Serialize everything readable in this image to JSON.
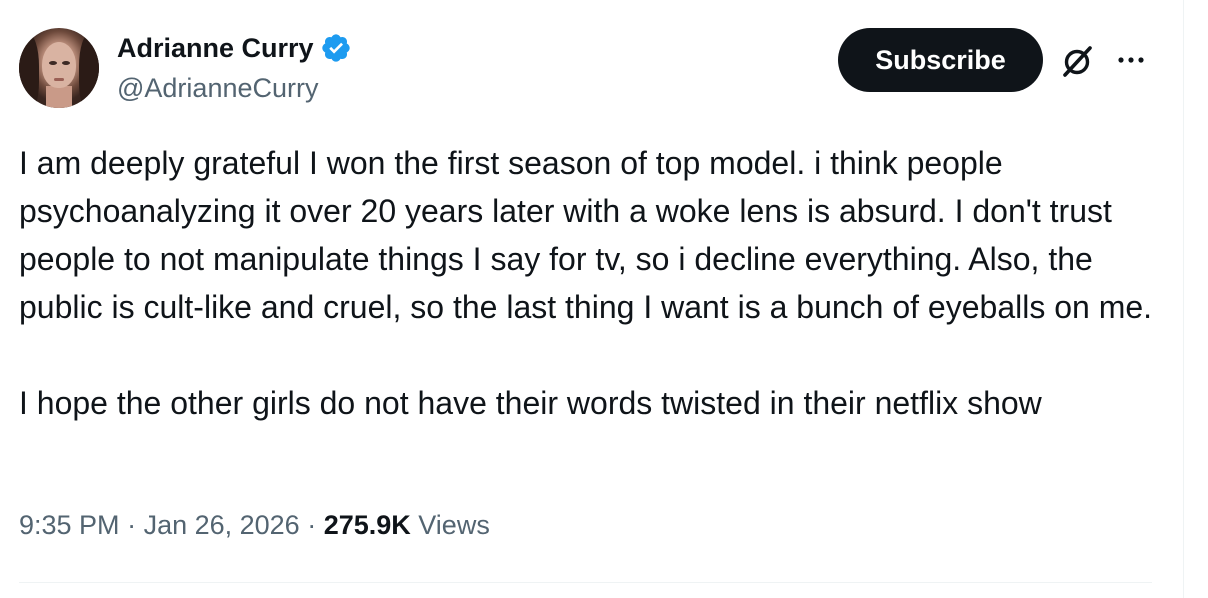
{
  "author": {
    "display_name": "Adrianne Curry",
    "handle": "@AdrianneCurry",
    "verified": true
  },
  "actions": {
    "subscribe_label": "Subscribe",
    "grok_icon": "grok-icon",
    "more_icon": "more-icon"
  },
  "tweet": {
    "paragraphs": [
      "I am deeply grateful I won the first season of top model. i think people psychoanalyzing it over 20 years later with a woke lens is absurd. I don't trust people to not manipulate things I say for tv, so i decline everything. Also, the public is cult-like and cruel, so the last thing I want is a bunch of eyeballs on me.",
      "I hope the other girls do not have their words twisted in their netflix show"
    ]
  },
  "meta": {
    "time": "9:35 PM",
    "date": "Jan 26, 2026",
    "separator": " · ",
    "views_count": "275.9K",
    "views_label": " Views"
  },
  "colors": {
    "text_primary": "#0f1419",
    "text_secondary": "#536471",
    "verified_blue": "#1d9bf0",
    "button_bg": "#0f1419"
  }
}
